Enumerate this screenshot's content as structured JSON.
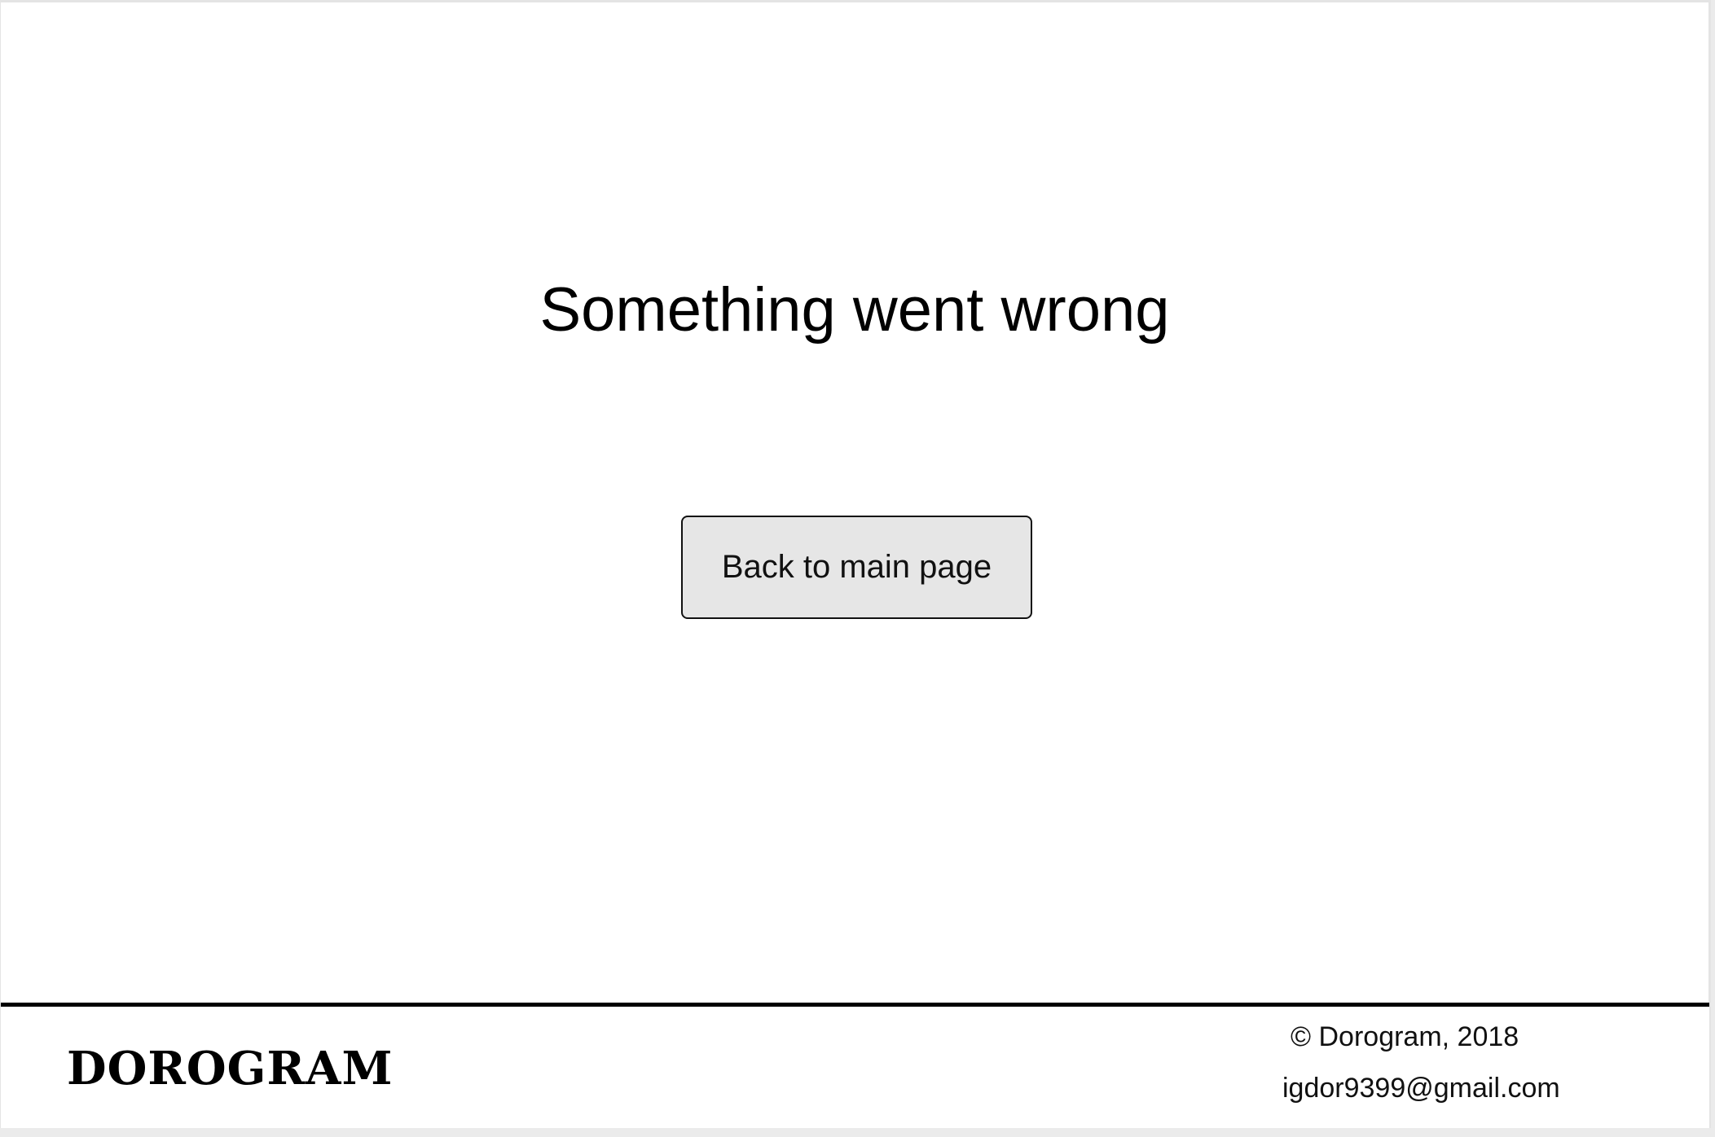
{
  "main": {
    "heading": "Something went wrong",
    "back_button_label": "Back to main page"
  },
  "footer": {
    "logo": "DOROGRAM",
    "copyright": "© Dorogram, 2018",
    "email": "igdor9399@gmail.com"
  },
  "colors": {
    "page_background": "#ffffff",
    "button_background": "#e6e6e6",
    "footer_border": "#000000",
    "text": "#000000"
  }
}
